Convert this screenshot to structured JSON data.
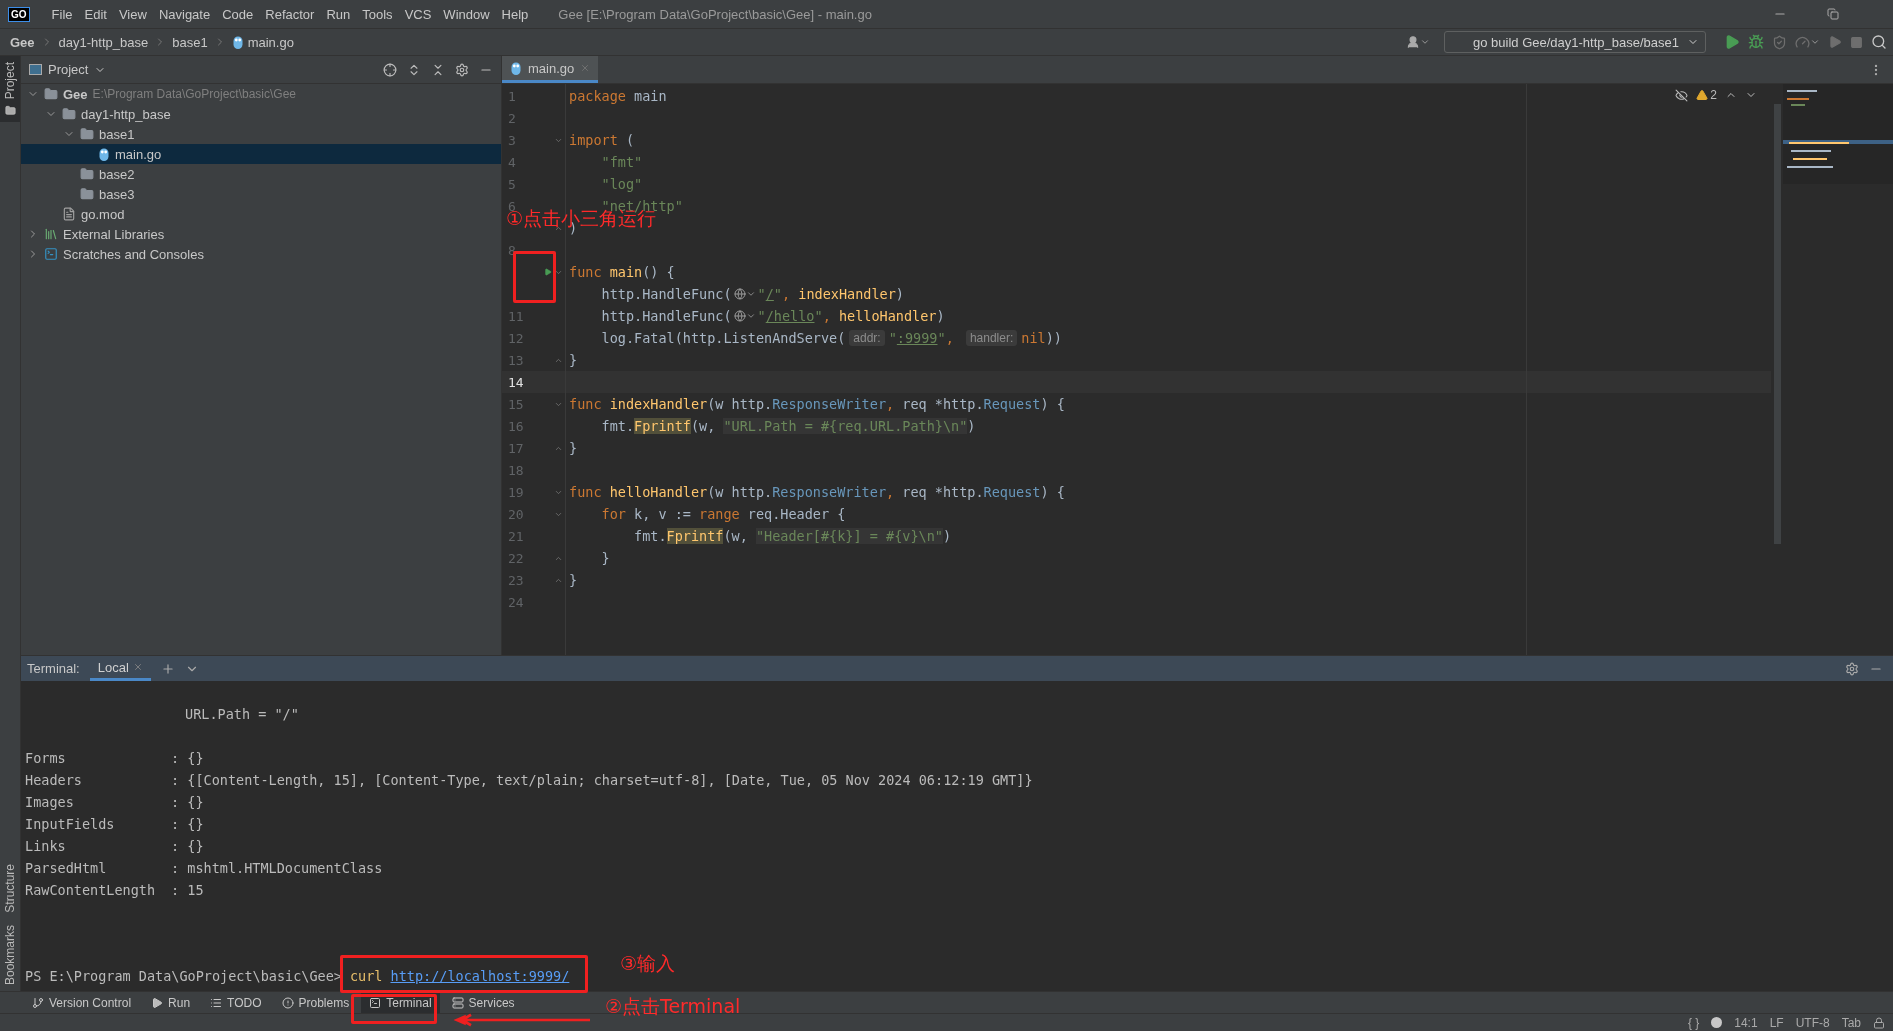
{
  "title_bar": {
    "logo": "GO",
    "menu": [
      "File",
      "Edit",
      "View",
      "Navigate",
      "Code",
      "Refactor",
      "Run",
      "Tools",
      "VCS",
      "Window",
      "Help"
    ],
    "title": "Gee [E:\\Program Data\\GoProject\\basic\\Gee] - main.go"
  },
  "nav_bar": {
    "breadcrumbs": [
      {
        "label": "Gee",
        "kind": "project"
      },
      {
        "label": "day1-http_base",
        "kind": "folder"
      },
      {
        "label": "base1",
        "kind": "folder"
      },
      {
        "label": "main.go",
        "kind": "gofile"
      }
    ],
    "run_config": "go build Gee/day1-http_base/base1"
  },
  "side_strip": {
    "top": [
      {
        "label": "Project",
        "selected": true
      }
    ],
    "bottom": [
      {
        "label": "Structure",
        "selected": false
      },
      {
        "label": "Bookmarks",
        "selected": false
      }
    ]
  },
  "project_panel": {
    "title": "Project",
    "tree": [
      {
        "label": "Gee",
        "path": "E:\\Program Data\\GoProject\\basic\\Gee",
        "kind": "project",
        "expanded": true,
        "selected": false,
        "children": [
          {
            "label": "day1-http_base",
            "kind": "folder",
            "expanded": true,
            "selected": false,
            "children": [
              {
                "label": "base1",
                "kind": "folder",
                "expanded": true,
                "selected": false,
                "children": [
                  {
                    "label": "main.go",
                    "kind": "gofile",
                    "selected": true
                  }
                ]
              },
              {
                "label": "base2",
                "kind": "folder",
                "selected": false
              },
              {
                "label": "base3",
                "kind": "folder",
                "selected": false
              }
            ]
          },
          {
            "label": "go.mod",
            "kind": "modfile",
            "selected": false
          }
        ]
      },
      {
        "label": "External Libraries",
        "kind": "library",
        "expanded": false,
        "selected": false
      },
      {
        "label": "Scratches and Consoles",
        "kind": "scratches",
        "expanded": false,
        "selected": false
      }
    ]
  },
  "editor": {
    "tabs": [
      {
        "label": "main.go",
        "selected": true
      }
    ],
    "warning_count": "2",
    "lines": [
      {
        "number": "1",
        "current": false,
        "segments": [
          {
            "kind": "kw",
            "text": "package"
          },
          {
            "kind": "plain",
            "text": " main"
          }
        ]
      },
      {
        "number": "2",
        "current": false
      },
      {
        "number": "3",
        "current": false,
        "fold_start": true,
        "segments": [
          {
            "kind": "kw",
            "text": "import"
          },
          {
            "kind": "plain",
            "text": " ("
          }
        ]
      },
      {
        "number": "4",
        "current": false,
        "segments": [
          {
            "kind": "str",
            "text": "    \"fmt\""
          }
        ]
      },
      {
        "number": "5",
        "current": false,
        "segments": [
          {
            "kind": "str",
            "text": "    \"log\""
          }
        ]
      },
      {
        "number": "6",
        "current": false,
        "segments": [
          {
            "kind": "str",
            "text": "    \"net/http\""
          }
        ]
      },
      {
        "fold_end": true,
        "segments": [
          {
            "kind": "plain",
            "text": ")"
          }
        ]
      },
      {
        "number": "8"
      },
      {
        "fold_start": true,
        "run_button": true,
        "segments": [
          {
            "kind": "kw",
            "text": "func "
          },
          {
            "kind": "fn",
            "text": "main"
          },
          {
            "kind": "plain",
            "text": "() {"
          }
        ]
      },
      {
        "segments": [
          {
            "kind": "plain",
            "text": "    http.HandleFunc("
          },
          {
            "kind": "globe"
          },
          {
            "kind": "str",
            "text": "\""
          },
          {
            "kind": "link",
            "text": "/"
          },
          {
            "kind": "str",
            "text": "\""
          },
          {
            "kind": "kw",
            "text": ", "
          },
          {
            "kind": "fn",
            "text": "indexHandler"
          },
          {
            "kind": "plain",
            "text": ")"
          }
        ]
      },
      {
        "number": "11",
        "current": false,
        "segments": [
          {
            "kind": "plain",
            "text": "    http.HandleFunc("
          },
          {
            "kind": "globe"
          },
          {
            "kind": "str",
            "text": "\""
          },
          {
            "kind": "link",
            "text": "/hello"
          },
          {
            "kind": "str",
            "text": "\""
          },
          {
            "kind": "kw",
            "text": ", "
          },
          {
            "kind": "fn",
            "text": "helloHandler"
          },
          {
            "kind": "plain",
            "text": ")"
          }
        ]
      },
      {
        "number": "12",
        "current": false,
        "segments": [
          {
            "kind": "plain",
            "text": "    log.Fatal(http.ListenAndServe("
          },
          {
            "kind": "hint",
            "text": "addr:"
          },
          {
            "kind": "str",
            "text": "\""
          },
          {
            "kind": "link",
            "text": ":9999"
          },
          {
            "kind": "str",
            "text": "\""
          },
          {
            "kind": "kw",
            "text": ", "
          },
          {
            "kind": "hint",
            "text": "handler:"
          },
          {
            "kind": "kw",
            "text": "nil"
          },
          {
            "kind": "plain",
            "text": "))"
          }
        ]
      },
      {
        "number": "13",
        "current": false,
        "fold_end": true,
        "segments": [
          {
            "kind": "plain",
            "text": "}"
          }
        ]
      },
      {
        "number": "14",
        "current": true
      },
      {
        "number": "15",
        "current": false,
        "fold_start": true,
        "segments": [
          {
            "kind": "kw",
            "text": "func "
          },
          {
            "kind": "fn",
            "text": "indexHandler"
          },
          {
            "kind": "plain",
            "text": "(w http."
          },
          {
            "kind": "type",
            "text": "ResponseWriter"
          },
          {
            "kind": "kw",
            "text": ", "
          },
          {
            "kind": "plain",
            "text": "req *http."
          },
          {
            "kind": "type",
            "text": "Request"
          },
          {
            "kind": "plain",
            "text": ") {"
          }
        ]
      },
      {
        "number": "16",
        "current": false,
        "segments": [
          {
            "kind": "plain",
            "text": "    fmt."
          },
          {
            "kind": "mark",
            "text": "Fprintf"
          },
          {
            "kind": "plain",
            "text": "(w, "
          },
          {
            "kind": "fmtstr",
            "text": "\"URL.Path = #{req.URL.Path}\\n\""
          },
          {
            "kind": "plain",
            "text": ")"
          }
        ]
      },
      {
        "number": "17",
        "current": false,
        "fold_end": true,
        "segments": [
          {
            "kind": "plain",
            "text": "}"
          }
        ]
      },
      {
        "number": "18",
        "current": false
      },
      {
        "number": "19",
        "current": false,
        "fold_start": true,
        "segments": [
          {
            "kind": "kw",
            "text": "func "
          },
          {
            "kind": "fn",
            "text": "helloHandler"
          },
          {
            "kind": "plain",
            "text": "(w http."
          },
          {
            "kind": "type",
            "text": "ResponseWriter"
          },
          {
            "kind": "kw",
            "text": ", "
          },
          {
            "kind": "plain",
            "text": "req *http."
          },
          {
            "kind": "type",
            "text": "Request"
          },
          {
            "kind": "plain",
            "text": ") {"
          }
        ]
      },
      {
        "number": "20",
        "current": false,
        "fold_start": true,
        "segments": [
          {
            "kind": "kw",
            "text": "    for"
          },
          {
            "kind": "plain",
            "text": " k, v := "
          },
          {
            "kind": "kw",
            "text": "range"
          },
          {
            "kind": "plain",
            "text": " req.Header {"
          }
        ]
      },
      {
        "number": "21",
        "current": false,
        "segments": [
          {
            "kind": "plain",
            "text": "        fmt."
          },
          {
            "kind": "mark",
            "text": "Fprintf"
          },
          {
            "kind": "plain",
            "text": "(w, "
          },
          {
            "kind": "fmtstr",
            "text": "\"Header[#{k}] = #{v}\\n\""
          },
          {
            "kind": "plain",
            "text": ")"
          }
        ]
      },
      {
        "number": "22",
        "current": false,
        "fold_end": true,
        "segments": [
          {
            "kind": "plain",
            "text": "    }"
          }
        ]
      },
      {
        "number": "23",
        "current": false,
        "fold_end": true,
        "segments": [
          {
            "kind": "plain",
            "text": "}"
          }
        ]
      },
      {
        "number": "24",
        "current": false
      }
    ]
  },
  "terminal": {
    "label": "Terminal:",
    "tabs": [
      {
        "label": "Local",
        "selected": true
      }
    ],
    "output": [
      {
        "kind": "output",
        "text": "URL.Path = \"/\""
      },
      {
        "kind": "field",
        "name": "Forms",
        "value": ": {}"
      },
      {
        "kind": "field",
        "name": "Headers",
        "value": ": {[Content-Length, 15], [Content-Type, text/plain; charset=utf-8], [Date, Tue, 05 Nov 2024 06:12:19 GMT]}"
      },
      {
        "kind": "field",
        "name": "Images",
        "value": ": {}"
      },
      {
        "kind": "field",
        "name": "InputFields",
        "value": ": {}"
      },
      {
        "kind": "field",
        "name": "Links",
        "value": ": {}"
      },
      {
        "kind": "field",
        "name": "ParsedHtml",
        "value": ": mshtml.HTMLDocumentClass"
      },
      {
        "kind": "field",
        "name": "RawContentLength",
        "value": ": 15"
      }
    ],
    "prompt": {
      "path": "PS E:\\Program Data\\GoProject\\basic\\Gee>",
      "command": "curl",
      "argument": "http://localhost:9999/"
    }
  },
  "tool_tabs": [
    {
      "label": "Version Control",
      "kind": "vcs",
      "selected": false
    },
    {
      "label": "Run",
      "kind": "run",
      "selected": false
    },
    {
      "label": "TODO",
      "kind": "todo",
      "selected": false
    },
    {
      "label": "Problems",
      "kind": "problems",
      "selected": false
    },
    {
      "label": "Terminal",
      "kind": "terminal",
      "selected": true
    },
    {
      "label": "Services",
      "kind": "services",
      "selected": false
    }
  ],
  "status_bar": [
    "{ }",
    "14:1",
    "LF",
    "UTF-8",
    "Tab"
  ],
  "annotations": [
    {
      "kind": "box"
    },
    {
      "kind": "label",
      "text": "①点击小三角运行"
    },
    {
      "kind": "box"
    },
    {
      "kind": "label",
      "text": "③输入"
    },
    {
      "kind": "box"
    },
    {
      "kind": "arrow"
    },
    {
      "kind": "label",
      "text": "②点击Terminal"
    }
  ]
}
